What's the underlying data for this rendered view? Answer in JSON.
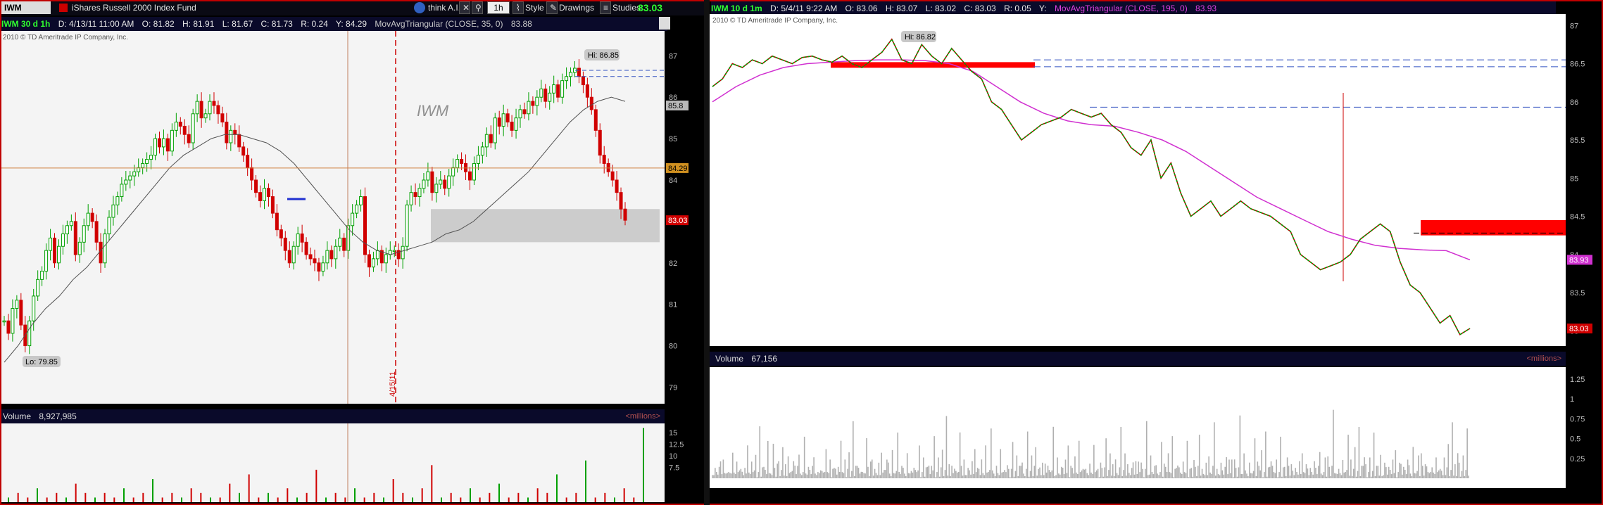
{
  "toolbar": {
    "symbol": "IWM",
    "description": "iShares Russell 2000 Index Fund",
    "think_ai": "think A.I.",
    "interval": "1h",
    "style": "Style",
    "drawings": "Drawings",
    "studies": "Studies",
    "last_price": "83.03"
  },
  "left_chart": {
    "info": {
      "symbol": "IWM 30 d 1h",
      "date": "D: 4/13/11 11:00 AM",
      "open": "O: 81.82",
      "high": "H: 81.91",
      "low": "L: 81.67",
      "close": "C: 81.73",
      "range": "R: 0.24",
      "y": "Y: 84.29",
      "study": "MovAvgTriangular (CLOSE, 35, 0)",
      "study_value": "83.88"
    },
    "copyright": "2010 © TD Ameritrade IP Company, Inc.",
    "watermark": "IWM",
    "hi_label": "Hi: 86.85",
    "lo_label": "Lo: 79.85",
    "date_marker": "4/15/11",
    "price_tags": {
      "ma": "85.8",
      "cursor": "84.29",
      "last": "83.03"
    },
    "y_ticks": [
      "87",
      "86",
      "85",
      "84",
      "83",
      "82",
      "81",
      "80",
      "79"
    ],
    "volume_label": "Volume",
    "volume_value": "8,927,985",
    "millions": "<millions>",
    "vol_ticks": [
      "15",
      "12.5",
      "10",
      "7.5"
    ]
  },
  "right_chart": {
    "info": {
      "symbol": "IWM 10 d 1m",
      "date": "D: 5/4/11 9:22 AM",
      "open": "O: 83.06",
      "high": "H: 83.07",
      "low": "L: 83.02",
      "close": "C: 83.03",
      "range": "R: 0.05",
      "y": "Y:",
      "study": "MovAvgTriangular (CLOSE, 195, 0)",
      "study_value": "83.93"
    },
    "copyright": "2010 © TD Ameritrade IP Company, Inc.",
    "hi_label": "Hi: 86.82",
    "price_tags": {
      "ma": "83.93",
      "last": "83.03"
    },
    "y_ticks": [
      "87",
      "86.5",
      "86",
      "85.5",
      "85",
      "84.5",
      "84",
      "83.5",
      "83"
    ],
    "volume_label": "Volume",
    "volume_value": "67,156",
    "millions": "<millions>",
    "vol_ticks": [
      "1.25",
      "1",
      "0.75",
      "0.5",
      "0.25"
    ]
  },
  "colors": {
    "up": "#00a000",
    "down": "#d00000",
    "ma_left": "#505050",
    "ma_right": "#d030d0",
    "zone_gray": "#c8c8c8",
    "zone_red": "#ff0000",
    "dash_blue": "#3050c0"
  },
  "chart_data": [
    {
      "type": "candlestick",
      "title": "IWM 30 d 1h",
      "ylim": [
        78.6,
        87.6
      ],
      "hi": 86.85,
      "lo": 79.85,
      "close_path": [
        80.6,
        80.3,
        80.9,
        81.1,
        80.5,
        80.0,
        80.6,
        81.2,
        81.6,
        81.8,
        82.3,
        82.6,
        82.0,
        82.4,
        82.7,
        82.9,
        83.0,
        82.2,
        82.5,
        82.9,
        83.2,
        83.0,
        82.5,
        82.0,
        82.7,
        83.1,
        83.4,
        83.6,
        83.9,
        84.0,
        84.1,
        84.2,
        84.3,
        84.4,
        84.5,
        84.6,
        85.0,
        84.8,
        85.0,
        84.7,
        85.2,
        85.4,
        85.3,
        85.1,
        84.9,
        85.6,
        85.9,
        85.5,
        85.6,
        85.9,
        85.8,
        85.6,
        85.4,
        84.9,
        85.2,
        85.1,
        84.8,
        84.6,
        84.3,
        84.0,
        83.7,
        83.5,
        83.8,
        83.6,
        83.2,
        82.8,
        82.6,
        82.3,
        82.0,
        82.4,
        82.7,
        82.5,
        82.2,
        82.1,
        82.0,
        81.8,
        82.0,
        82.3,
        82.1,
        82.4,
        82.6,
        82.3,
        82.9,
        83.2,
        83.4,
        83.6,
        82.2,
        81.9,
        82.1,
        82.3,
        82.0,
        82.2,
        82.3,
        82.3,
        82.1,
        82.4,
        83.4,
        83.7,
        83.6,
        83.8,
        84.0,
        84.2,
        83.7,
        83.9,
        84.0,
        83.8,
        84.1,
        84.3,
        84.5,
        84.4,
        84.2,
        84.0,
        84.4,
        84.6,
        84.8,
        85.1,
        84.9,
        85.5,
        85.3,
        85.6,
        85.4,
        85.2,
        85.5,
        85.7,
        85.6,
        85.9,
        85.8,
        86.0,
        86.2,
        85.9,
        86.1,
        86.3,
        86.0,
        86.4,
        86.5,
        86.6,
        86.7,
        86.5,
        86.3,
        86.0,
        85.7,
        85.2,
        84.6,
        84.4,
        84.2,
        84.0,
        83.7,
        83.3,
        83.03
      ],
      "ma_path": [
        79.6,
        80.0,
        80.5,
        80.9,
        81.2,
        81.6,
        81.9,
        82.3,
        82.7,
        83.1,
        83.5,
        83.9,
        84.3,
        84.6,
        84.8,
        85.0,
        85.1,
        85.1,
        85.0,
        84.9,
        84.7,
        84.4,
        84.0,
        83.6,
        83.2,
        82.8,
        82.5,
        82.3,
        82.2,
        82.3,
        82.4,
        82.5,
        82.7,
        82.8,
        83.0,
        83.3,
        83.6,
        83.9,
        84.2,
        84.6,
        85.0,
        85.4,
        85.7,
        85.9,
        86.0,
        85.9
      ],
      "date_marker": "4/15/11",
      "cursor_y": 84.29,
      "zones": [
        {
          "from": 82.5,
          "to": 83.3,
          "color": "gray"
        }
      ],
      "volume": [
        1,
        2,
        1,
        3,
        1,
        2,
        1,
        4,
        2,
        1,
        2,
        1,
        3,
        1,
        2,
        5,
        1,
        2,
        1,
        3,
        2,
        1,
        1,
        4,
        2,
        6,
        1,
        2,
        1,
        3,
        1,
        2,
        7,
        1,
        2,
        1,
        3,
        1,
        2,
        1,
        5,
        2,
        1,
        3,
        8,
        1,
        2,
        1,
        3,
        1,
        2,
        4,
        1,
        2,
        1,
        3,
        2,
        6,
        1,
        2,
        9,
        1,
        2,
        1,
        3,
        1,
        16
      ]
    },
    {
      "type": "line",
      "title": "IWM 10 d 1m",
      "ylim": [
        82.8,
        87.15
      ],
      "hi": 86.82,
      "close_path": [
        86.2,
        86.3,
        86.5,
        86.45,
        86.55,
        86.5,
        86.6,
        86.55,
        86.5,
        86.58,
        86.6,
        86.55,
        86.52,
        86.6,
        86.5,
        86.45,
        86.55,
        86.65,
        86.82,
        86.55,
        86.5,
        86.75,
        86.6,
        86.5,
        86.7,
        86.55,
        86.4,
        86.3,
        86.0,
        85.9,
        85.7,
        85.5,
        85.6,
        85.7,
        85.75,
        85.8,
        85.9,
        85.85,
        85.8,
        85.85,
        85.7,
        85.6,
        85.4,
        85.3,
        85.5,
        85.0,
        85.2,
        84.8,
        84.5,
        84.6,
        84.7,
        84.5,
        84.6,
        84.7,
        84.6,
        84.55,
        84.5,
        84.4,
        84.3,
        84.0,
        83.9,
        83.8,
        83.85,
        83.9,
        84.0,
        84.2,
        84.3,
        84.4,
        84.3,
        83.9,
        83.6,
        83.5,
        83.3,
        83.1,
        83.2,
        82.95,
        83.03
      ],
      "ma_path": [
        86.0,
        86.2,
        86.35,
        86.45,
        86.5,
        86.52,
        86.54,
        86.55,
        86.55,
        86.54,
        86.5,
        86.4,
        86.2,
        86.0,
        85.85,
        85.75,
        85.7,
        85.68,
        85.6,
        85.5,
        85.35,
        85.15,
        84.95,
        84.75,
        84.6,
        84.45,
        84.3,
        84.2,
        84.12,
        84.08,
        84.06,
        84.05,
        83.93
      ],
      "zones": [
        {
          "from": 86.45,
          "to": 86.5,
          "color": "red"
        },
        {
          "from": 84.25,
          "to": 84.45,
          "color": "red"
        }
      ],
      "volume": [
        3,
        1,
        2,
        4,
        1,
        2,
        8,
        1,
        3,
        2,
        1,
        5,
        2,
        1,
        3,
        7,
        1,
        2,
        4,
        1,
        3,
        2,
        6,
        1,
        2,
        3,
        9,
        1,
        2,
        4,
        1,
        3,
        5,
        1,
        2,
        10,
        1,
        3,
        2,
        4,
        1,
        6,
        2,
        1,
        3,
        11,
        2,
        1,
        4,
        3,
        1,
        2,
        5,
        1,
        3,
        2,
        7,
        1,
        4,
        2,
        3,
        6,
        1,
        2,
        9,
        1,
        3,
        2,
        8
      ]
    }
  ]
}
